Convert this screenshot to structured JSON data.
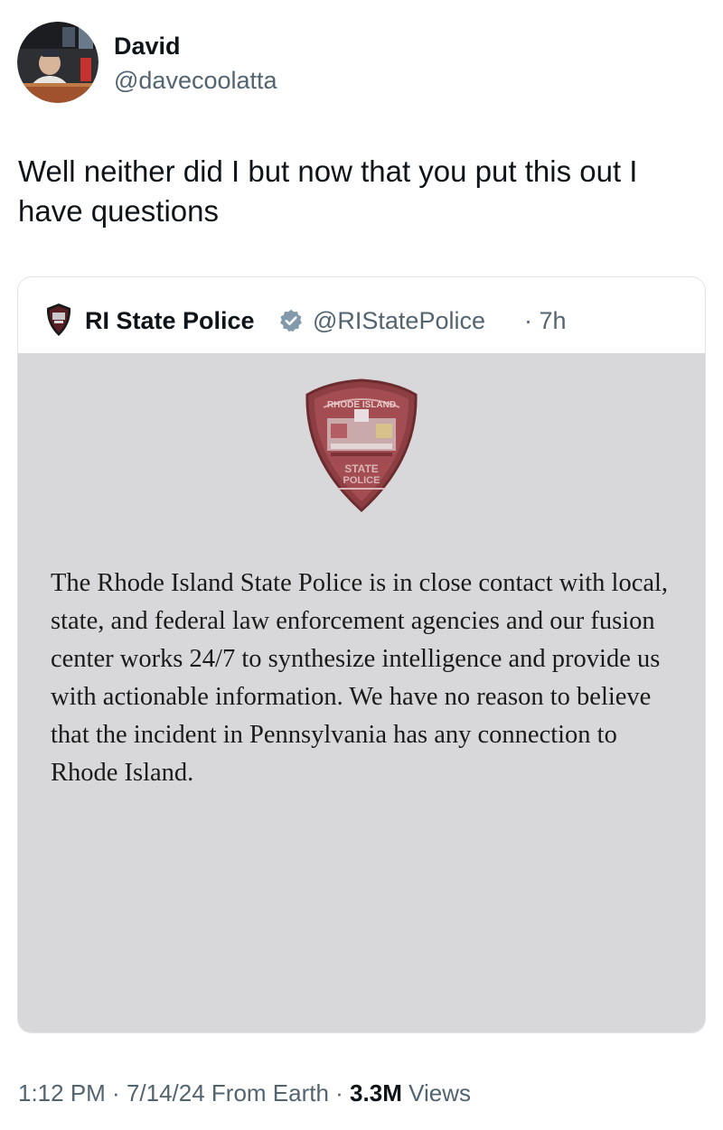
{
  "author": {
    "display_name": "David",
    "handle": "@davecoolatta"
  },
  "tweet": {
    "text": "Well neither did I but now that you put this out I have questions"
  },
  "quoted_tweet": {
    "display_name": "RI State Police",
    "verified": true,
    "handle": "@RIStatePolice",
    "time": "· 7h",
    "image": {
      "statement": "The Rhode Island State Police is in close contact with local, state, and federal law enforcement agencies and our fusion center works 24/7 to synthesize intelligence and provide us with actionable information. We have no reason to believe that the incident in Pennsylvania has any connection to Rhode Island.",
      "badge_text_top": "RHODE ISLAND",
      "badge_text_line1": "STATE",
      "badge_text_line2": "POLICE"
    }
  },
  "meta": {
    "time": "1:12 PM",
    "sep1": " · ",
    "date": "7/14/24",
    "source": " From Earth",
    "sep2": " · ",
    "views_count": "3.3M",
    "views_label": " Views"
  },
  "colors": {
    "primary_text": "#0f1419",
    "secondary_text": "#536471",
    "verified_badge": "#829aab",
    "image_background": "#d8d8da",
    "badge_red": "#9c3a3f"
  },
  "icons": {
    "verified": "verified-badge-icon",
    "avatar": "user-avatar",
    "agency_logo": "ri-state-police-logo-icon"
  }
}
